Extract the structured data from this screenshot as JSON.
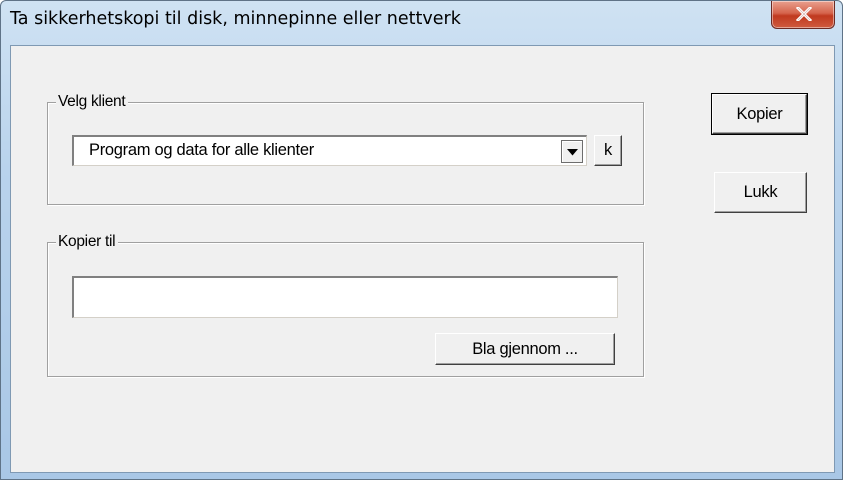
{
  "window": {
    "title": "Ta sikkerhetskopi til disk, minnepinne eller nettverk",
    "close_icon": "close-x-icon"
  },
  "client_group": {
    "label": "Velg klient",
    "selected": "Program og data for alle klienter",
    "dropdown_icon": "chevron-down-icon",
    "k_button_label": "k"
  },
  "copy_to_group": {
    "label": "Kopier til",
    "path_value": "",
    "browse_label": "Bla gjennom ..."
  },
  "actions": {
    "copy_label": "Kopier",
    "close_label": "Lukk"
  }
}
